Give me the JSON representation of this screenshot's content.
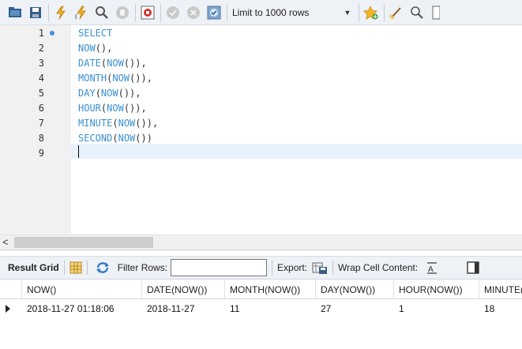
{
  "toolbar": {
    "icons": [
      "folder-open-icon",
      "save-icon",
      "execute-icon",
      "execute-current-icon",
      "explain-icon",
      "stop-icon",
      "toggle-error-icon",
      "commit-icon",
      "rollback-icon",
      "autocommit-icon",
      "bookmark-add-icon",
      "beautify-icon",
      "find-icon",
      "invisible-chars-icon"
    ],
    "limit_label": "Limit to 1000 rows"
  },
  "editor": {
    "line_numbers": [
      "1",
      "2",
      "3",
      "4",
      "5",
      "6",
      "7",
      "8",
      "9"
    ],
    "lines": [
      {
        "fn": "SELECT",
        "inner": "",
        "close": ""
      },
      {
        "fn": "NOW",
        "inner": "",
        "close": "(),"
      },
      {
        "fn": "DATE",
        "inner": "NOW",
        "close": "()),"
      },
      {
        "fn": "MONTH",
        "inner": "NOW",
        "close": "()),"
      },
      {
        "fn": "DAY",
        "inner": "NOW",
        "close": "()),"
      },
      {
        "fn": "HOUR",
        "inner": "NOW",
        "close": "()),"
      },
      {
        "fn": "MINUTE",
        "inner": "NOW",
        "close": "()),"
      },
      {
        "fn": "SECOND",
        "inner": "NOW",
        "close": "())"
      },
      {
        "fn": "",
        "inner": "",
        "close": ""
      }
    ]
  },
  "result_toolbar": {
    "result_grid_label": "Result Grid",
    "filter_label": "Filter Rows:",
    "filter_value": "",
    "export_label": "Export:",
    "wrap_label": "Wrap Cell Content:"
  },
  "grid": {
    "columns": [
      "NOW()",
      "DATE(NOW())",
      "MONTH(NOW())",
      "DAY(NOW())",
      "HOUR(NOW())",
      "MINUTE(NOW())"
    ],
    "rows": [
      [
        "2018-11-27 01:18:06",
        "2018-11-27",
        "11",
        "27",
        "1",
        "18"
      ]
    ]
  },
  "colors": {
    "keyword": "#3a8fd0",
    "gutter": "#f1f1f1",
    "toolbar": "#eef1f5",
    "current_line": "#e8f2fb"
  }
}
